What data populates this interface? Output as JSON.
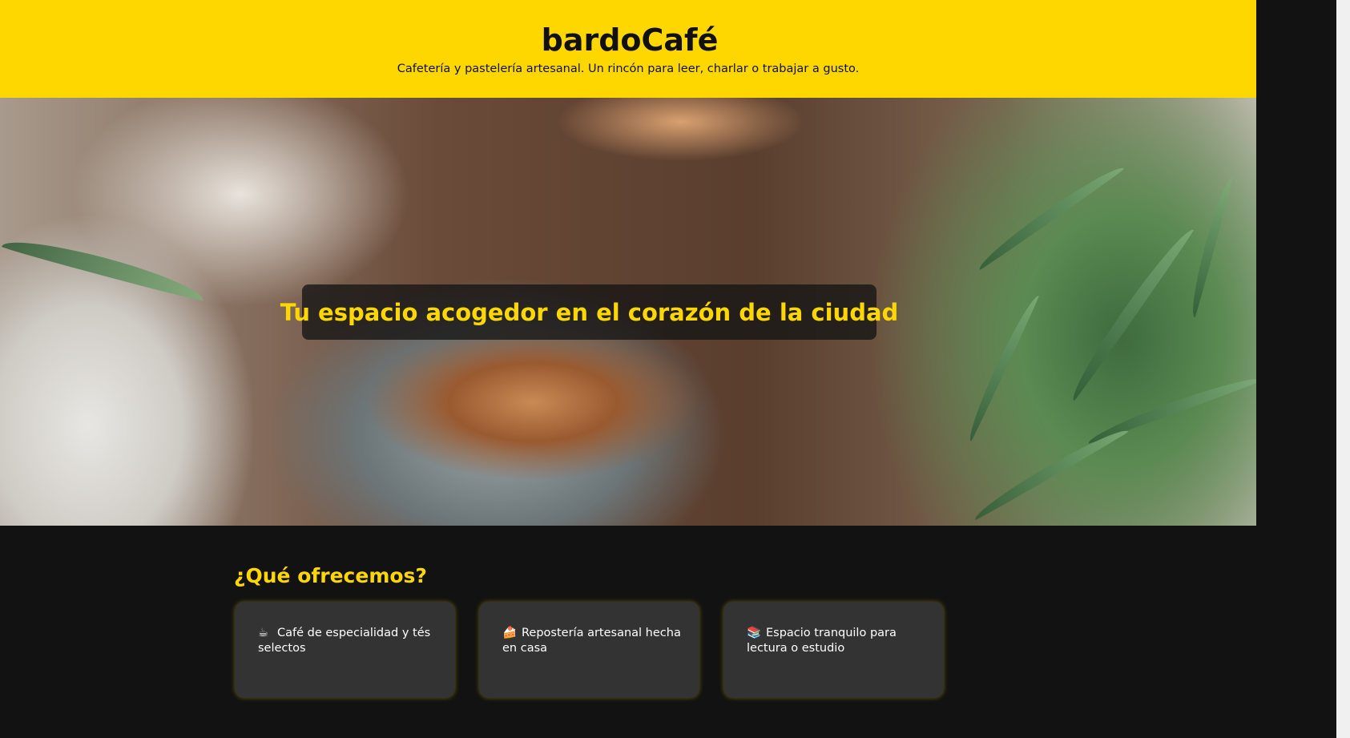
{
  "header": {
    "title": "bardoCafé",
    "tagline": "Cafetería y pastelería artesanal. Un rincón para leer, charlar o trabajar a gusto."
  },
  "hero": {
    "heading": "Tu espacio acogedor en el corazón de la ciudad"
  },
  "offers": {
    "title": "¿Qué ofrecemos?",
    "items": [
      {
        "emoji": "☕",
        "icon": "coffee-icon",
        "text": "Café de especialidad y tés selectos"
      },
      {
        "emoji": "🍰",
        "icon": "cake-icon",
        "text": "Repostería artesanal hecha en casa"
      },
      {
        "emoji": "📚",
        "icon": "books-icon",
        "text": "Espacio tranquilo para lectura o estudio"
      }
    ]
  },
  "colors": {
    "brand_yellow": "#ffd700",
    "dark_background": "#121212",
    "card_background": "#333333"
  }
}
